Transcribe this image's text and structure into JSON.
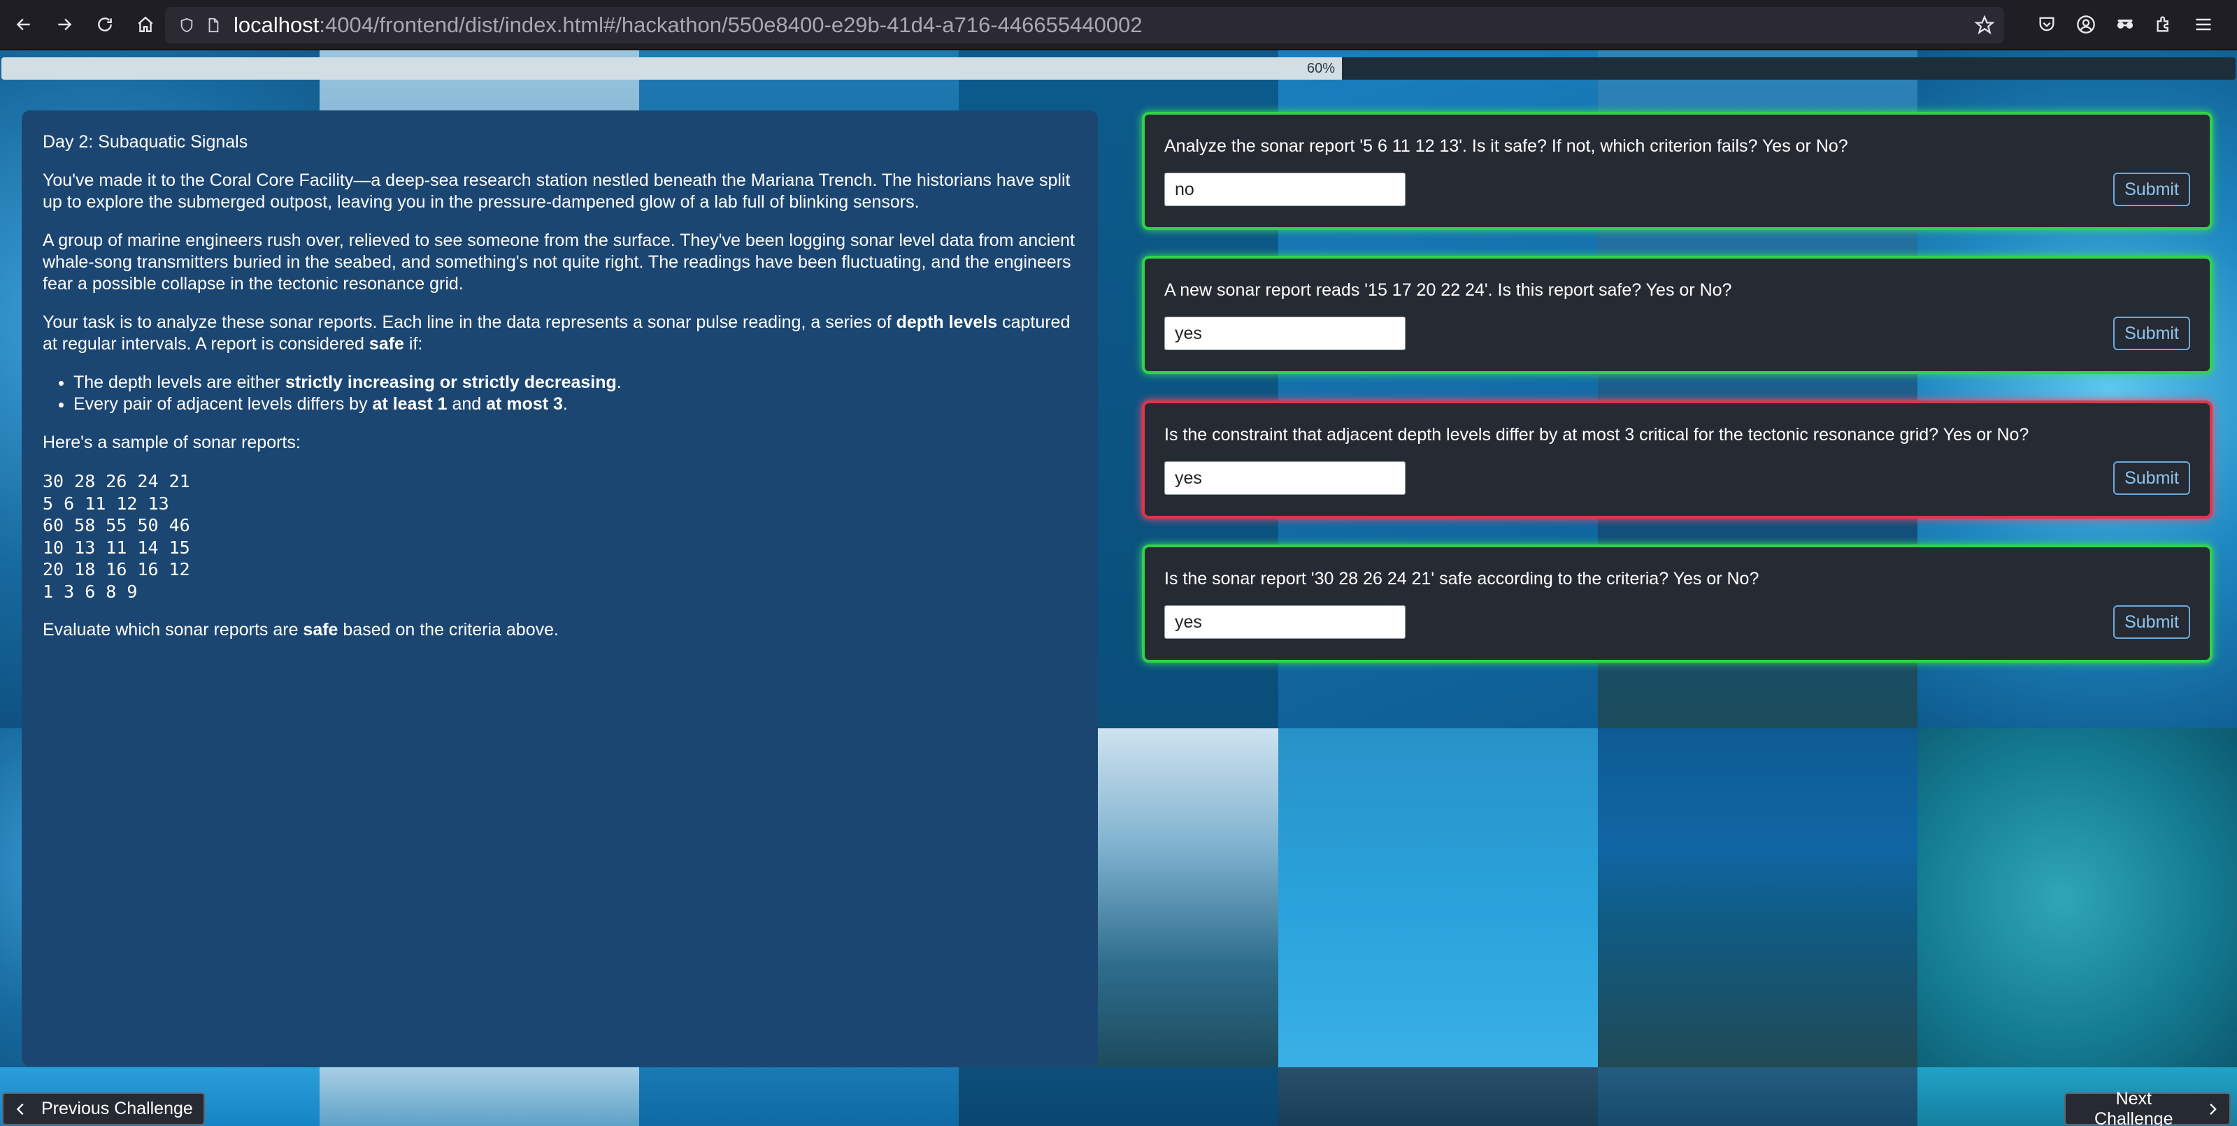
{
  "browser": {
    "url_host": "localhost",
    "url_path": ":4004/frontend/dist/index.html#/hackathon/550e8400-e29b-41d4-a716-446655440002",
    "icons": [
      "back-icon",
      "forward-icon",
      "reload-icon",
      "home-icon",
      "shield-icon",
      "page-icon",
      "bookmark-star-icon",
      "pocket-icon",
      "account-icon",
      "extension-glasses-icon",
      "extensions-icon",
      "menu-icon"
    ]
  },
  "progress": {
    "value": 0.6,
    "label": "60%"
  },
  "challenge": {
    "title": "Day 2: Subaquatic Signals",
    "p1": "You've made it to the Coral Core Facility—a deep-sea research station nestled beneath the Mariana Trench. The historians have split up to explore the submerged outpost, leaving you in the pressure-dampened glow of a lab full of blinking sensors.",
    "p2": "A group of marine engineers rush over, relieved to see someone from the surface. They've been logging sonar level data from ancient whale-song transmitters buried in the seabed, and something's not quite right. The readings have been fluctuating, and the engineers fear a possible collapse in the tectonic resonance grid.",
    "p3_a": "Your task is to analyze these sonar reports. Each line in the data represents a sonar pulse reading, a series of ",
    "p3_b": "depth levels",
    "p3_c": " captured at regular intervals. A report is considered ",
    "p3_d": "safe",
    "p3_e": " if:",
    "li1_a": "The depth levels are either ",
    "li1_b": "strictly increasing or strictly decreasing",
    "li1_c": ".",
    "li2_a": "Every pair of adjacent levels differs by ",
    "li2_b": "at least 1",
    "li2_c": " and ",
    "li2_d": "at most 3",
    "li2_e": ".",
    "sample_intro": "Here's a sample of sonar reports:",
    "samples": [
      "30 28 26 24 21",
      "5 6 11 12 13",
      "60 58 55 50 46",
      "10 13 11 14 15",
      "20 18 16 16 12",
      "1 3 6 8 9"
    ],
    "final_a": "Evaluate which sonar reports are ",
    "final_b": "safe",
    "final_c": " based on the criteria above."
  },
  "questions": [
    {
      "text": "Analyze the sonar report '5 6 11 12 13'. Is it safe? If not, which criterion fails? Yes or No?",
      "answer": "no",
      "status": "correct",
      "submit_label": "Submit"
    },
    {
      "text": "A new sonar report reads '15 17 20 22 24'. Is this report safe? Yes or No?",
      "answer": "yes",
      "status": "correct",
      "submit_label": "Submit"
    },
    {
      "text": "Is the constraint that adjacent depth levels differ by at most 3 critical for the tectonic resonance grid? Yes or No?",
      "answer": "yes",
      "status": "incorrect",
      "submit_label": "Submit"
    },
    {
      "text": "Is the sonar report '30 28 26 24 21' safe according to the criteria? Yes or No?",
      "answer": "yes",
      "status": "correct",
      "submit_label": "Submit"
    }
  ],
  "navigation": {
    "prev_label": "Previous Challenge",
    "next_label": "Next Challenge"
  },
  "colors": {
    "correct": "#2fd34a",
    "incorrect": "#e0344a",
    "panel": "#1c4672",
    "card": "#262b33"
  }
}
